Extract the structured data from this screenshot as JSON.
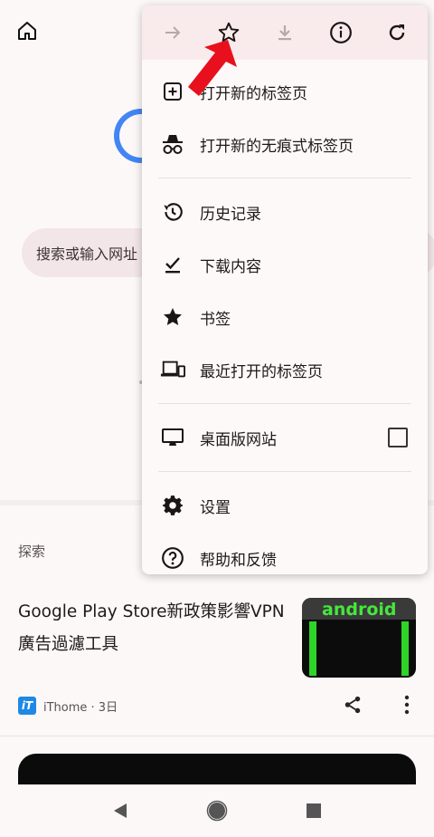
{
  "page": {
    "search_placeholder": "搜索或输入网址",
    "explore_label": "探索"
  },
  "article": {
    "title": "Google Play Store新政策影響VPN廣告過濾工具",
    "thumb_text": "android",
    "source_logo": "iT",
    "source": "iThome · 3日"
  },
  "menu": {
    "toolbar": {
      "forward_icon": "arrow-right-icon",
      "bookmark_icon": "star-outline-icon",
      "download_icon": "download-icon",
      "info_icon": "info-icon",
      "reload_icon": "reload-icon"
    },
    "items": [
      {
        "label": "打开新的标签页",
        "icon": "plus-box-icon"
      },
      {
        "label": "打开新的无痕式标签页",
        "icon": "incognito-icon"
      },
      {
        "label": "历史记录",
        "icon": "history-icon"
      },
      {
        "label": "下载内容",
        "icon": "download-check-icon"
      },
      {
        "label": "书签",
        "icon": "star-filled-icon"
      },
      {
        "label": "最近打开的标签页",
        "icon": "devices-icon"
      },
      {
        "label": "桌面版网站",
        "icon": "desktop-icon",
        "checked": false
      },
      {
        "label": "设置",
        "icon": "gear-icon"
      },
      {
        "label": "帮助和反馈",
        "icon": "help-icon"
      }
    ]
  },
  "colors": {
    "accent_red": "#e8101c",
    "menu_toolbar_bg": "#f9ebec",
    "search_bg": "#f3e6e8"
  }
}
